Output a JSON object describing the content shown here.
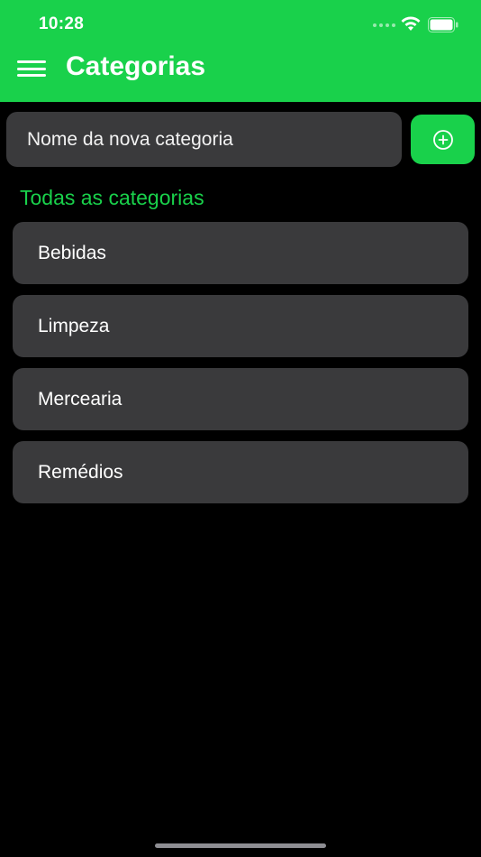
{
  "status_bar": {
    "time": "10:28"
  },
  "header": {
    "title": "Categorias",
    "menu_icon": "hamburger-menu-icon",
    "color": "#19d14b"
  },
  "new_category": {
    "placeholder": "Nome da nova categoria",
    "value": "",
    "add_icon": "plus-circle-icon"
  },
  "section_title": "Todas as categorias",
  "categories": [
    {
      "label": "Bebidas"
    },
    {
      "label": "Limpeza"
    },
    {
      "label": "Mercearia"
    },
    {
      "label": "Remédios"
    }
  ]
}
